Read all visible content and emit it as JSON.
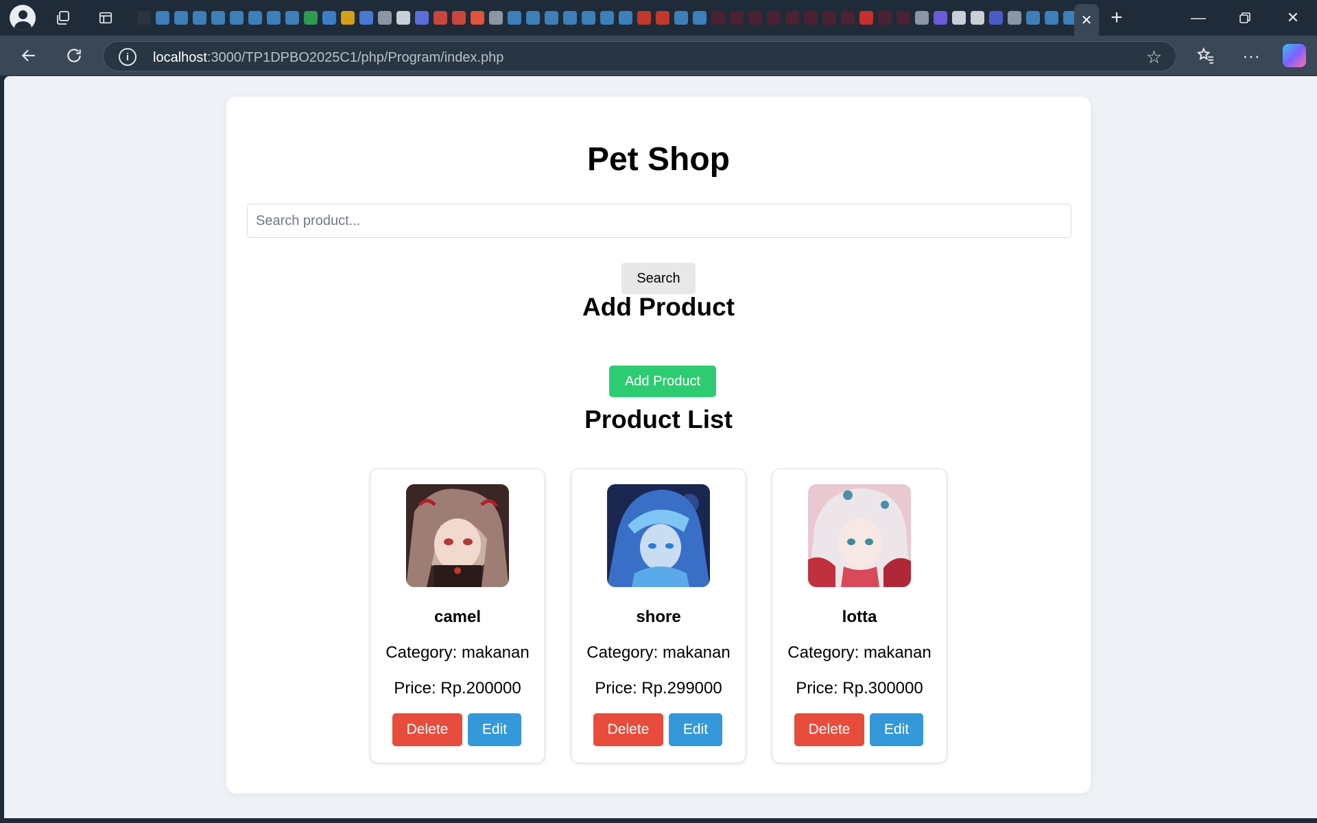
{
  "browser": {
    "url_host": "localhost",
    "url_path": ":3000/TP1DPBO2025C1/php/Program/index.php",
    "tab_favicons": [
      {
        "icon": "cat-icon",
        "color": "#2b3440"
      },
      {
        "icon": "calendar-icon",
        "color": "#3d7fb8"
      },
      {
        "icon": "calendar-icon",
        "color": "#3d7fb8"
      },
      {
        "icon": "calendar-icon",
        "color": "#3d7fb8"
      },
      {
        "icon": "calendar-icon",
        "color": "#3d7fb8"
      },
      {
        "icon": "calendar-icon",
        "color": "#3d7fb8"
      },
      {
        "icon": "calendar-icon",
        "color": "#3d7fb8"
      },
      {
        "icon": "calendar-icon",
        "color": "#3d7fb8"
      },
      {
        "icon": "calendar-icon",
        "color": "#3d7fb8"
      },
      {
        "icon": "sheets-icon",
        "color": "#2e9a52"
      },
      {
        "icon": "contacts-icon",
        "color": "#3a7ec8"
      },
      {
        "icon": "slides-icon",
        "color": "#d4a017"
      },
      {
        "icon": "docs-icon",
        "color": "#4a78d4"
      },
      {
        "icon": "globe-icon",
        "color": "#8a96a3"
      },
      {
        "icon": "github-icon",
        "color": "#c8cfd6"
      },
      {
        "icon": "app-icon",
        "color": "#5b6ed8"
      },
      {
        "icon": "gmail-icon",
        "color": "#c9463d"
      },
      {
        "icon": "gmail-icon",
        "color": "#c9463d"
      },
      {
        "icon": "figma-icon",
        "color": "#e0543b"
      },
      {
        "icon": "app-icon",
        "color": "#8a96a3"
      },
      {
        "icon": "document-icon",
        "color": "#3d7fb8"
      },
      {
        "icon": "document-icon",
        "color": "#3d7fb8"
      },
      {
        "icon": "document-icon",
        "color": "#3d7fb8"
      },
      {
        "icon": "document-icon",
        "color": "#3d7fb8"
      },
      {
        "icon": "document-icon",
        "color": "#3d7fb8"
      },
      {
        "icon": "document-icon",
        "color": "#3d7fb8"
      },
      {
        "icon": "document-icon",
        "color": "#3d7fb8"
      },
      {
        "icon": "scribd-icon",
        "color": "#c0392b"
      },
      {
        "icon": "scribd-icon",
        "color": "#c0392b"
      },
      {
        "icon": "document-icon",
        "color": "#3d7fb8"
      },
      {
        "icon": "document-icon",
        "color": "#3d7fb8"
      },
      {
        "icon": "media-icon",
        "color": "#4a2233"
      },
      {
        "icon": "media-icon",
        "color": "#4a2233"
      },
      {
        "icon": "media-icon",
        "color": "#4a2233"
      },
      {
        "icon": "media-icon",
        "color": "#4a2233"
      },
      {
        "icon": "media-icon",
        "color": "#4a2233"
      },
      {
        "icon": "media-icon",
        "color": "#4a2233"
      },
      {
        "icon": "media-icon",
        "color": "#4a2233"
      },
      {
        "icon": "media-icon",
        "color": "#4a2233"
      },
      {
        "icon": "youtube-icon",
        "color": "#c4302b"
      },
      {
        "icon": "media-icon",
        "color": "#4a2233"
      },
      {
        "icon": "media-icon",
        "color": "#4a2233"
      },
      {
        "icon": "gauge-icon",
        "color": "#8a96a3"
      },
      {
        "icon": "app-icon",
        "color": "#6b5bd8"
      },
      {
        "icon": "github-icon",
        "color": "#c8cfd6"
      },
      {
        "icon": "github-icon",
        "color": "#c8cfd6"
      },
      {
        "icon": "app-icon",
        "color": "#4a5bc8"
      },
      {
        "icon": "globe-icon",
        "color": "#8a96a3"
      },
      {
        "icon": "search-icon",
        "color": "#3d7fb8"
      },
      {
        "icon": "document-icon",
        "color": "#3d7fb8"
      },
      {
        "icon": "document-icon",
        "color": "#3d7fb8"
      }
    ]
  },
  "page": {
    "title": "Pet Shop",
    "search": {
      "placeholder": "Search product...",
      "value": "",
      "button_label": "Search"
    },
    "add_section": {
      "heading": "Add Product",
      "button_label": "Add Product"
    },
    "list_heading": "Product List",
    "colors": {
      "add": "#2ecc71",
      "delete": "#e74c3c",
      "edit": "#3498db"
    },
    "products": [
      {
        "name": "camel",
        "category": "Category: makanan",
        "price": "Price: Rp.200000",
        "delete_label": "Delete",
        "edit_label": "Edit"
      },
      {
        "name": "shore",
        "category": "Category: makanan",
        "price": "Price: Rp.299000",
        "delete_label": "Delete",
        "edit_label": "Edit"
      },
      {
        "name": "lotta",
        "category": "Category: makanan",
        "price": "Price: Rp.300000",
        "delete_label": "Delete",
        "edit_label": "Edit"
      }
    ]
  }
}
